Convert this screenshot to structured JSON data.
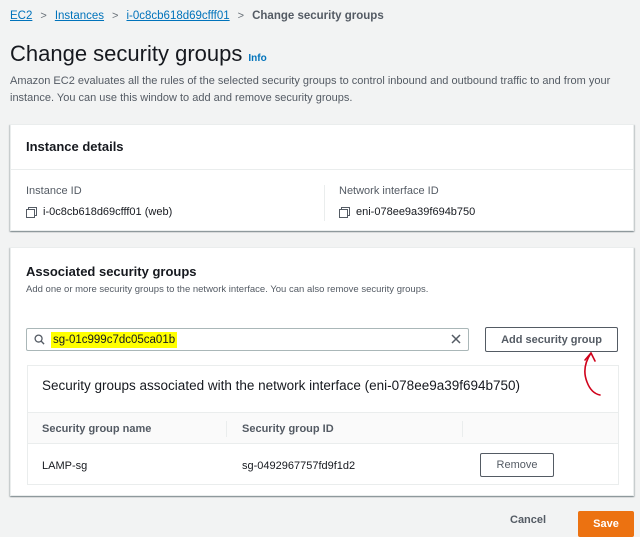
{
  "breadcrumb": {
    "items": [
      "EC2",
      "Instances",
      "i-0c8cb618d69cfff01"
    ],
    "current": "Change security groups",
    "separator": ">"
  },
  "page": {
    "title": "Change security groups",
    "info_label": "Info",
    "description": "Amazon EC2 evaluates all the rules of the selected security groups to control inbound and outbound traffic to and from your instance. You can use this window to add and remove security groups."
  },
  "instance_details": {
    "header": "Instance details",
    "instance_id_label": "Instance ID",
    "instance_id_value": "i-0c8cb618d69cfff01 (web)",
    "network_interface_label": "Network interface ID",
    "network_interface_value": "eni-078ee9a39f694b750"
  },
  "associated": {
    "title": "Associated security groups",
    "description": "Add one or more security groups to the network interface. You can also remove security groups.",
    "search_value": "sg-01c999c7dc05ca01b",
    "add_button_label": "Add security group",
    "table_title": "Security groups associated with the network interface (eni-078ee9a39f694b750)",
    "columns": [
      "Security group name",
      "Security group ID"
    ],
    "rows": [
      {
        "name": "LAMP-sg",
        "id": "sg-0492967757fd9f1d2",
        "action": "Remove"
      }
    ]
  },
  "footer": {
    "cancel_label": "Cancel",
    "save_label": "Save"
  },
  "colors": {
    "link": "#0073bb",
    "primary_button": "#ec7211",
    "highlight": "#ffff00",
    "annotation": "#d0021b"
  }
}
